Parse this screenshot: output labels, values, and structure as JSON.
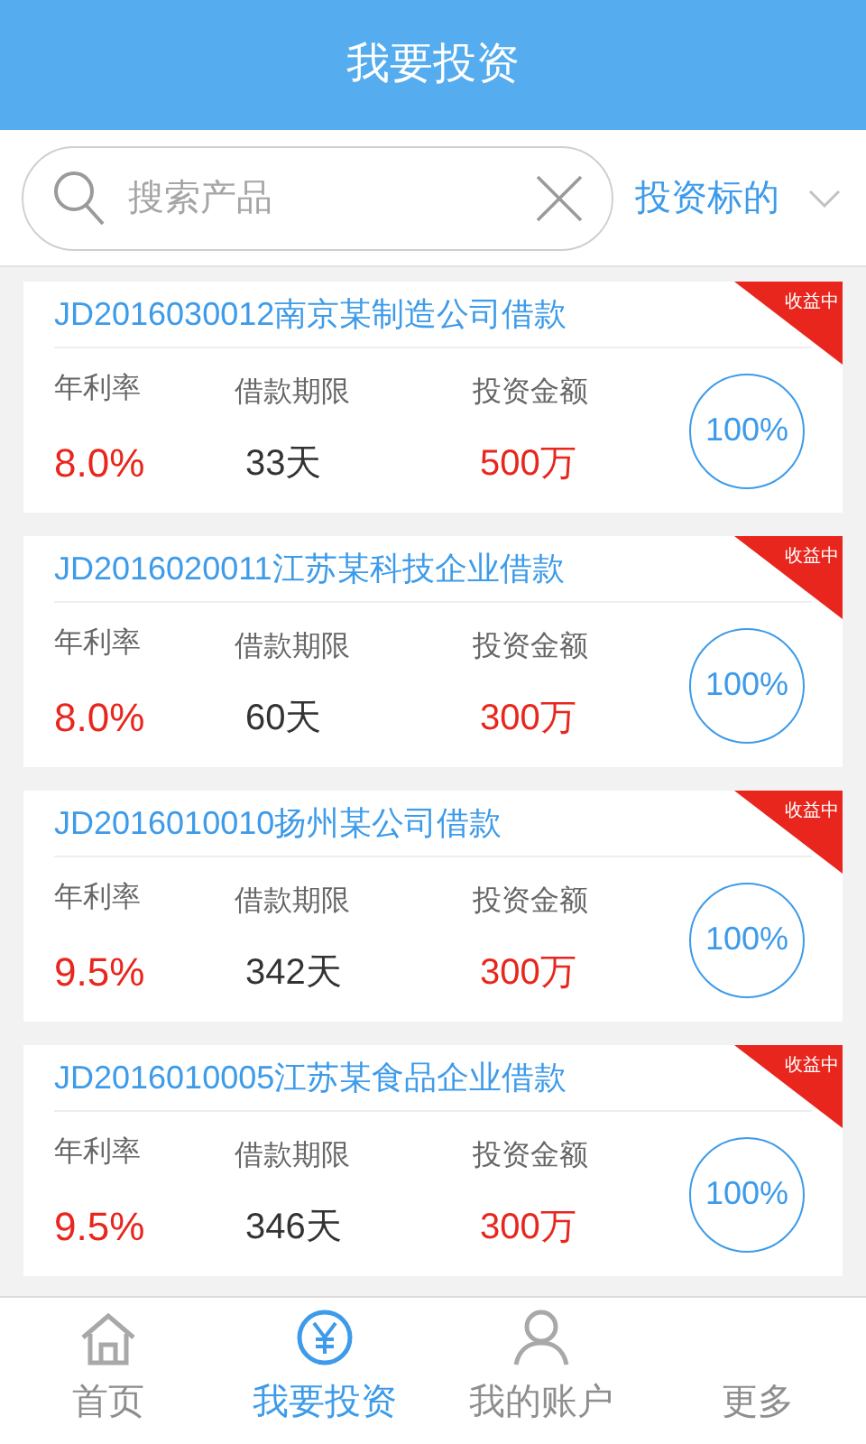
{
  "header": {
    "title": "我要投资"
  },
  "search": {
    "placeholder": "搜索产品",
    "filter": "投资标的"
  },
  "products": [
    {
      "name": "JD2016030012南京某制造公司借款",
      "status": "收益中",
      "rate_label": "年利率",
      "rate": "8.0%",
      "term_label": "借款期限",
      "term": "33天",
      "amount_label": "投资金额",
      "amount": "500万",
      "progress": "100%"
    },
    {
      "name": "JD2016020011江苏某科技企业借款",
      "status": "收益中",
      "rate_label": "年利率",
      "rate": "8.0%",
      "term_label": "借款期限",
      "term": "60天",
      "amount_label": "投资金额",
      "amount": "300万",
      "progress": "100%"
    },
    {
      "name": "JD2016010010扬州某公司借款",
      "status": "收益中",
      "rate_label": "年利率",
      "rate": "9.5%",
      "term_label": "借款期限",
      "term": "342天",
      "amount_label": "投资金额",
      "amount": "300万",
      "progress": "100%"
    },
    {
      "name": "JD2016010005江苏某食品企业借款",
      "status": "收益中",
      "rate_label": "年利率",
      "rate": "9.5%",
      "term_label": "借款期限",
      "term": "346天",
      "amount_label": "投资金额",
      "amount": "300万",
      "progress": "100%"
    }
  ],
  "nav": [
    {
      "label": "首页",
      "kind": "home",
      "selected": false
    },
    {
      "label": "我要投资",
      "kind": "invest",
      "selected": true
    },
    {
      "label": "我的账户",
      "kind": "account",
      "selected": false
    },
    {
      "label": "更多",
      "kind": "more",
      "selected": false
    }
  ]
}
